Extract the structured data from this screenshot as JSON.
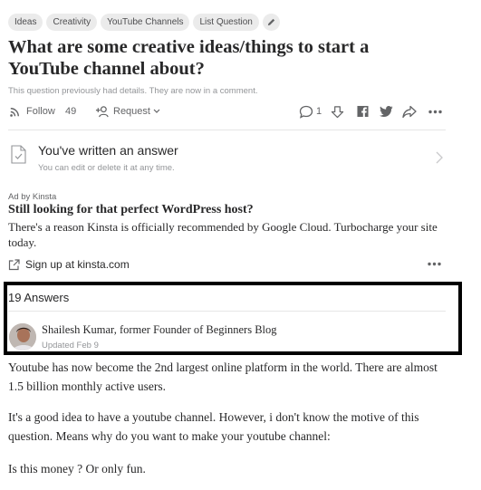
{
  "topics": [
    "Ideas",
    "Creativity",
    "YouTube Channels",
    "List Question"
  ],
  "question": {
    "title": "What are some creative ideas/things to start a YouTube channel about?",
    "details_note": "This question previously had details. They are now in a comment."
  },
  "actions": {
    "follow_label": "Follow",
    "follow_count": "49",
    "request_label": "Request",
    "comment_count": "1"
  },
  "written": {
    "title": "You've written an answer",
    "subtitle": "You can edit or delete it at any time."
  },
  "ad": {
    "label": "Ad by Kinsta",
    "headline": "Still looking for that perfect WordPress host?",
    "body": "There's a reason Kinsta is officially recommended by Google Cloud. Turbocharge your site today.",
    "link": "Sign up at kinsta.com"
  },
  "answers": {
    "count_label": "19 Answers",
    "author": "Shailesh Kumar, former Founder of Beginners Blog",
    "updated": "Updated Feb 9",
    "paragraphs": [
      "Youtube has now become the 2nd largest online platform in the world. There are almost 1.5 billion monthly active users.",
      "It's a good idea to have a youtube channel. However, i don't know the motive of this question. Means why do you want to make your youtube channel:",
      "Is this money ? Or only fun."
    ]
  },
  "icons": {
    "edit": "pencil-icon",
    "follow": "follow-rss-icon",
    "request": "request-user-icon",
    "comment": "comment-icon",
    "downvote": "downvote-icon",
    "facebook": "facebook-icon",
    "twitter": "twitter-icon",
    "share": "share-icon",
    "more": "more-icon",
    "written": "document-check-icon",
    "chevron": "chevron-right-icon",
    "external": "external-link-icon"
  },
  "colors": {
    "text": "#282829",
    "secondary": "#636466",
    "muted": "#939598",
    "chip_bg": "#ebebeb",
    "highlight_border": "#000000"
  }
}
